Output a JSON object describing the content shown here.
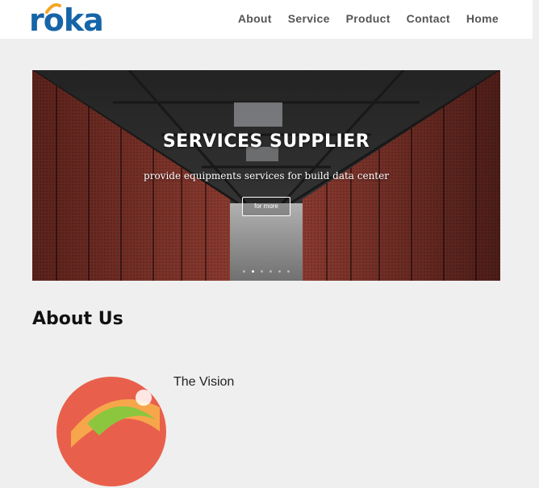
{
  "header": {
    "logo_text": "roka",
    "nav": [
      "About",
      "Service",
      "Product",
      "Contact",
      "Home"
    ]
  },
  "hero": {
    "title": "SERVICES SUPPLIER",
    "subtitle": "provide equipments services for build data center",
    "button_label": "for more",
    "slide_count": 6,
    "active_slide": 2
  },
  "about": {
    "title": "About Us",
    "vision_title": "The Vision"
  },
  "colors": {
    "brand_blue": "#1565a8",
    "brand_orange": "#f5a623",
    "page_bg": "#efefef",
    "rack_red": "#9a3b30"
  }
}
